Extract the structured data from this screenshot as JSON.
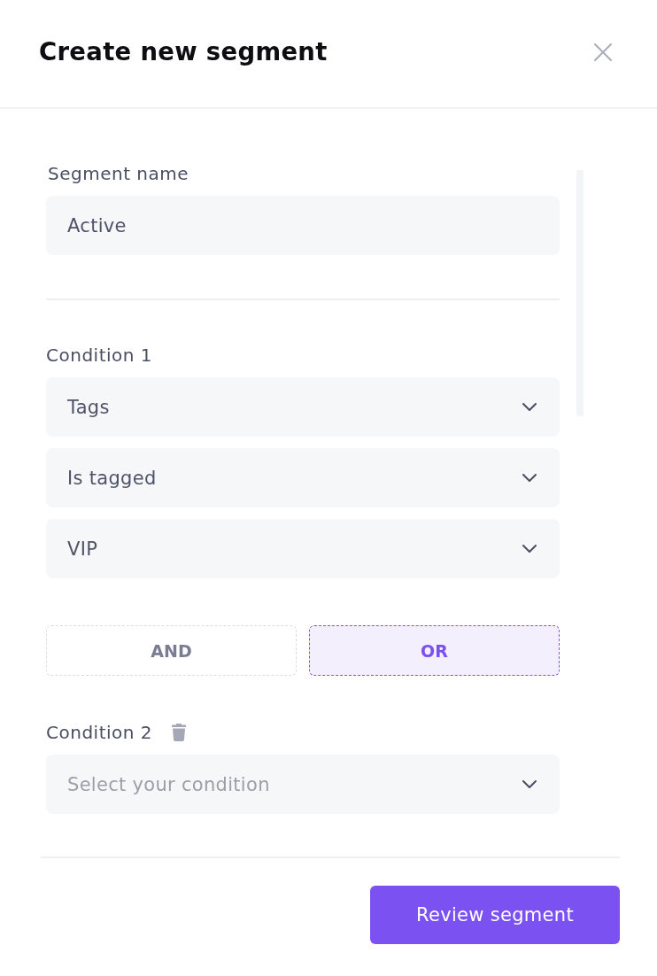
{
  "dialog": {
    "title": "Create new segment"
  },
  "segment_name": {
    "label": "Segment name",
    "value": "Active"
  },
  "blocks": [
    {
      "kind": "condition",
      "label": "Condition 1",
      "deletable": false,
      "fields": [
        {
          "value": "Tags"
        },
        {
          "value": "Is tagged"
        },
        {
          "value": "VIP"
        }
      ]
    },
    {
      "kind": "operator",
      "options": [
        {
          "label": "AND",
          "selected": false
        },
        {
          "label": "OR",
          "selected": true
        }
      ]
    },
    {
      "kind": "condition",
      "label": "Condition 2",
      "deletable": true,
      "fields": [
        {
          "placeholder": "Select your condition"
        }
      ]
    }
  ],
  "footer": {
    "button": "Review segment"
  }
}
